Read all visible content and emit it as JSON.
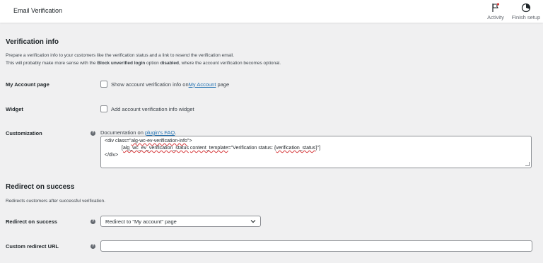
{
  "topbar": {
    "title": "Email Verification",
    "actions": [
      {
        "label": "Activity",
        "icon": "flag-icon"
      },
      {
        "label": "Finish setup",
        "icon": "progress-circle-icon"
      }
    ]
  },
  "verification_info": {
    "heading": "Verification info",
    "desc_line1": "Prepare a verification info to your customers like the verification status and a link to resend the verification email.",
    "desc_line2_pre": "This will probably make more sense with the ",
    "desc_line2_bold1": "Block unverified login",
    "desc_line2_mid": " option ",
    "desc_line2_bold2": "disabled",
    "desc_line2_post": ", where the account verification becomes optional.",
    "my_account": {
      "label": "My Account page",
      "text_pre": "Show account verification info on ",
      "link": "My Account",
      "text_post": " page",
      "checked": false
    },
    "widget": {
      "label": "Widget",
      "text": "Add account verification info widget",
      "checked": false
    },
    "customization": {
      "label": "Customization",
      "doc_pre": "Documentation on ",
      "doc_link": "plugin's FAQ",
      "doc_post": ".",
      "code_line1_pre": "<div class=\"",
      "code_line1_class": "alg-wc-ev-verification-info",
      "code_line1_post": "\">",
      "code_line2_pre": "[",
      "code_line2_sc": "alg_wc_ev_verification_status",
      "code_line2_mid": " ",
      "code_line2_attr": "content_template",
      "code_line2_val_pre": "=\"Verification status: {",
      "code_line2_var": "verification_status",
      "code_line2_post": "}\"]",
      "code_line3": "</div>"
    }
  },
  "redirect": {
    "heading": "Redirect on success",
    "desc": "Redirects customers after successful verification.",
    "select_label": "Redirect on success",
    "select_value": "Redirect to \"My account\" page",
    "url_label": "Custom redirect URL",
    "url_value": ""
  },
  "colors": {
    "background": "#f0f0f1",
    "link": "#2271b1",
    "border": "#8c8f94"
  }
}
